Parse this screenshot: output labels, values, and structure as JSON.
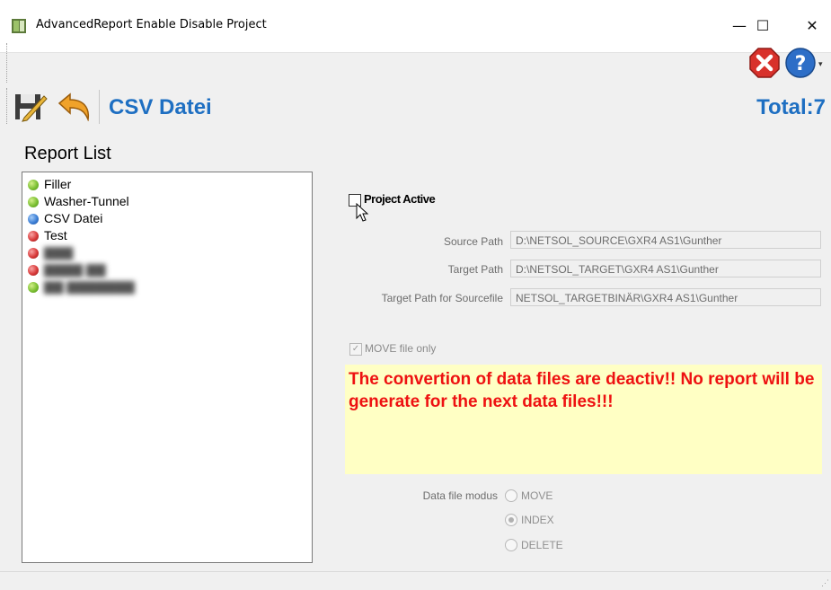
{
  "window": {
    "title": "AdvancedReport Enable Disable Project",
    "minimize_glyph": "—",
    "maximize_glyph": "☐",
    "close_glyph": "✕"
  },
  "toolbar": {
    "project_title": "CSV Datei",
    "total": "Total:7",
    "icons": [
      "save-icon",
      "undo-icon",
      "close-red-icon",
      "help-icon"
    ]
  },
  "report_list": {
    "label": "Report List",
    "items": [
      {
        "label": "Filler",
        "status": "green"
      },
      {
        "label": "Washer-Tunnel",
        "status": "green"
      },
      {
        "label": "CSV Datei",
        "status": "blue"
      },
      {
        "label": "Test",
        "status": "red"
      },
      {
        "label": "",
        "status": "red"
      },
      {
        "label": "",
        "status": "red"
      },
      {
        "label": "",
        "status": "green"
      }
    ]
  },
  "details": {
    "project_active_label": "Project Active",
    "source_path_label": "Source Path",
    "source_path_value": "D:\\NETSOL_SOURCE\\GXR4 AS1\\Gunther",
    "target_path_label": "Target Path",
    "target_path_value": "D:\\NETSOL_TARGET\\GXR4 AS1\\Gunther",
    "target_sourcefile_label": "Target Path for Sourcefile",
    "target_sourcefile_value": "NETSOL_TARGETBINÄR\\GXR4 AS1\\Gunther",
    "move_file_only_label": "MOVE file only",
    "message": "The convertion of data files are deactiv!! No report will be generate for the next data files!!!",
    "data_file_modus_label": "Data file modus",
    "modus_options": [
      "MOVE",
      "INDEX",
      "DELETE"
    ],
    "modus_selected": "INDEX"
  },
  "colors": {
    "accent": "#1e6fc2",
    "message_red": "#ee1111",
    "message_bg": "#ffffc4"
  }
}
